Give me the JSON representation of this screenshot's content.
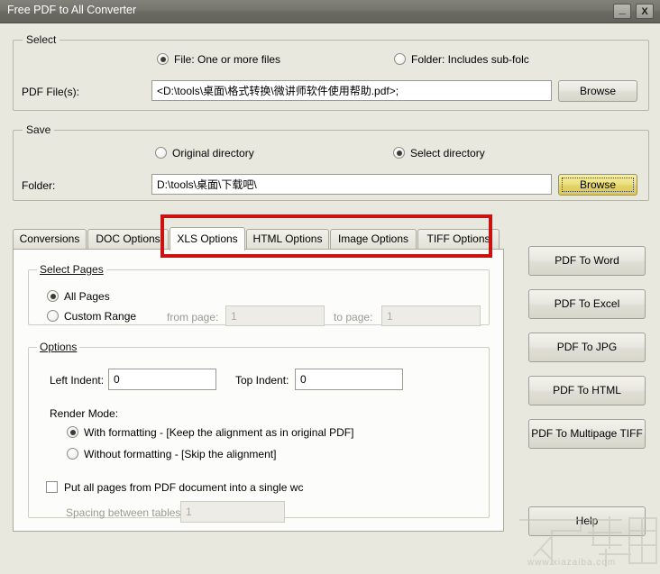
{
  "window": {
    "title": "Free PDF to All Converter",
    "minimize_label": "_",
    "close_label": "X"
  },
  "select_group": {
    "legend": "Select",
    "radio_file_label": "File:  One or more files",
    "radio_folder_label": "Folder: Includes sub-folc",
    "radio_file_checked": true,
    "radio_folder_checked": false,
    "file_label": "PDF File(s):",
    "file_value": "<D:\\tools\\桌面\\格式转换\\微讲师软件使用帮助.pdf>;",
    "browse_label": "Browse"
  },
  "save_group": {
    "legend": "Save",
    "radio_original_label": "Original directory",
    "radio_select_label": "Select directory",
    "radio_original_checked": false,
    "radio_select_checked": true,
    "folder_label": "Folder:",
    "folder_value": "D:\\tools\\桌面\\下载吧\\",
    "browse_label": "Browse"
  },
  "tabs": [
    {
      "label": "Conversions",
      "active": false
    },
    {
      "label": "DOC Options",
      "active": false
    },
    {
      "label": "XLS Options",
      "active": true
    },
    {
      "label": "HTML Options",
      "active": false
    },
    {
      "label": "Image Options",
      "active": false
    },
    {
      "label": "TIFF Options",
      "active": false
    }
  ],
  "select_pages": {
    "legend": "Select Pages",
    "all_pages_label": "All Pages",
    "all_pages_checked": true,
    "custom_range_label": "Custom Range",
    "custom_range_checked": false,
    "from_page_label": "from page:",
    "from_page_value": "1",
    "to_page_label": "to page:",
    "to_page_value": "1"
  },
  "options": {
    "legend": "Options",
    "left_indent_label": "Left Indent:",
    "left_indent_value": "0",
    "top_indent_label": "Top Indent:",
    "top_indent_value": "0",
    "render_mode_label": "Render Mode:",
    "with_formatting_label": "With formatting - [Keep the alignment as in original PDF]",
    "with_formatting_checked": true,
    "without_formatting_label": "Without formatting - [Skip the alignment]",
    "without_formatting_checked": false,
    "single_doc_label": "Put all pages from PDF document into a single wc",
    "single_doc_checked": false,
    "spacing_label": "Spacing between tables:",
    "spacing_value": "1"
  },
  "action_buttons": [
    {
      "label": "PDF To Word"
    },
    {
      "label": "PDF To Excel"
    },
    {
      "label": "PDF To JPG"
    },
    {
      "label": "PDF To HTML"
    },
    {
      "label": "PDF To Multipage TIFF"
    }
  ],
  "help_button": {
    "label": "Help"
  },
  "watermark": {
    "site": "www.xiazaiba.com",
    "logo_text": "下载吧"
  },
  "colors": {
    "dialog_background": "#e8e8de",
    "titlebar": "#74746d",
    "annotation_red": "#cc1111",
    "gold_button": "#e8dc72",
    "panel_white": "#fcfcfa"
  }
}
